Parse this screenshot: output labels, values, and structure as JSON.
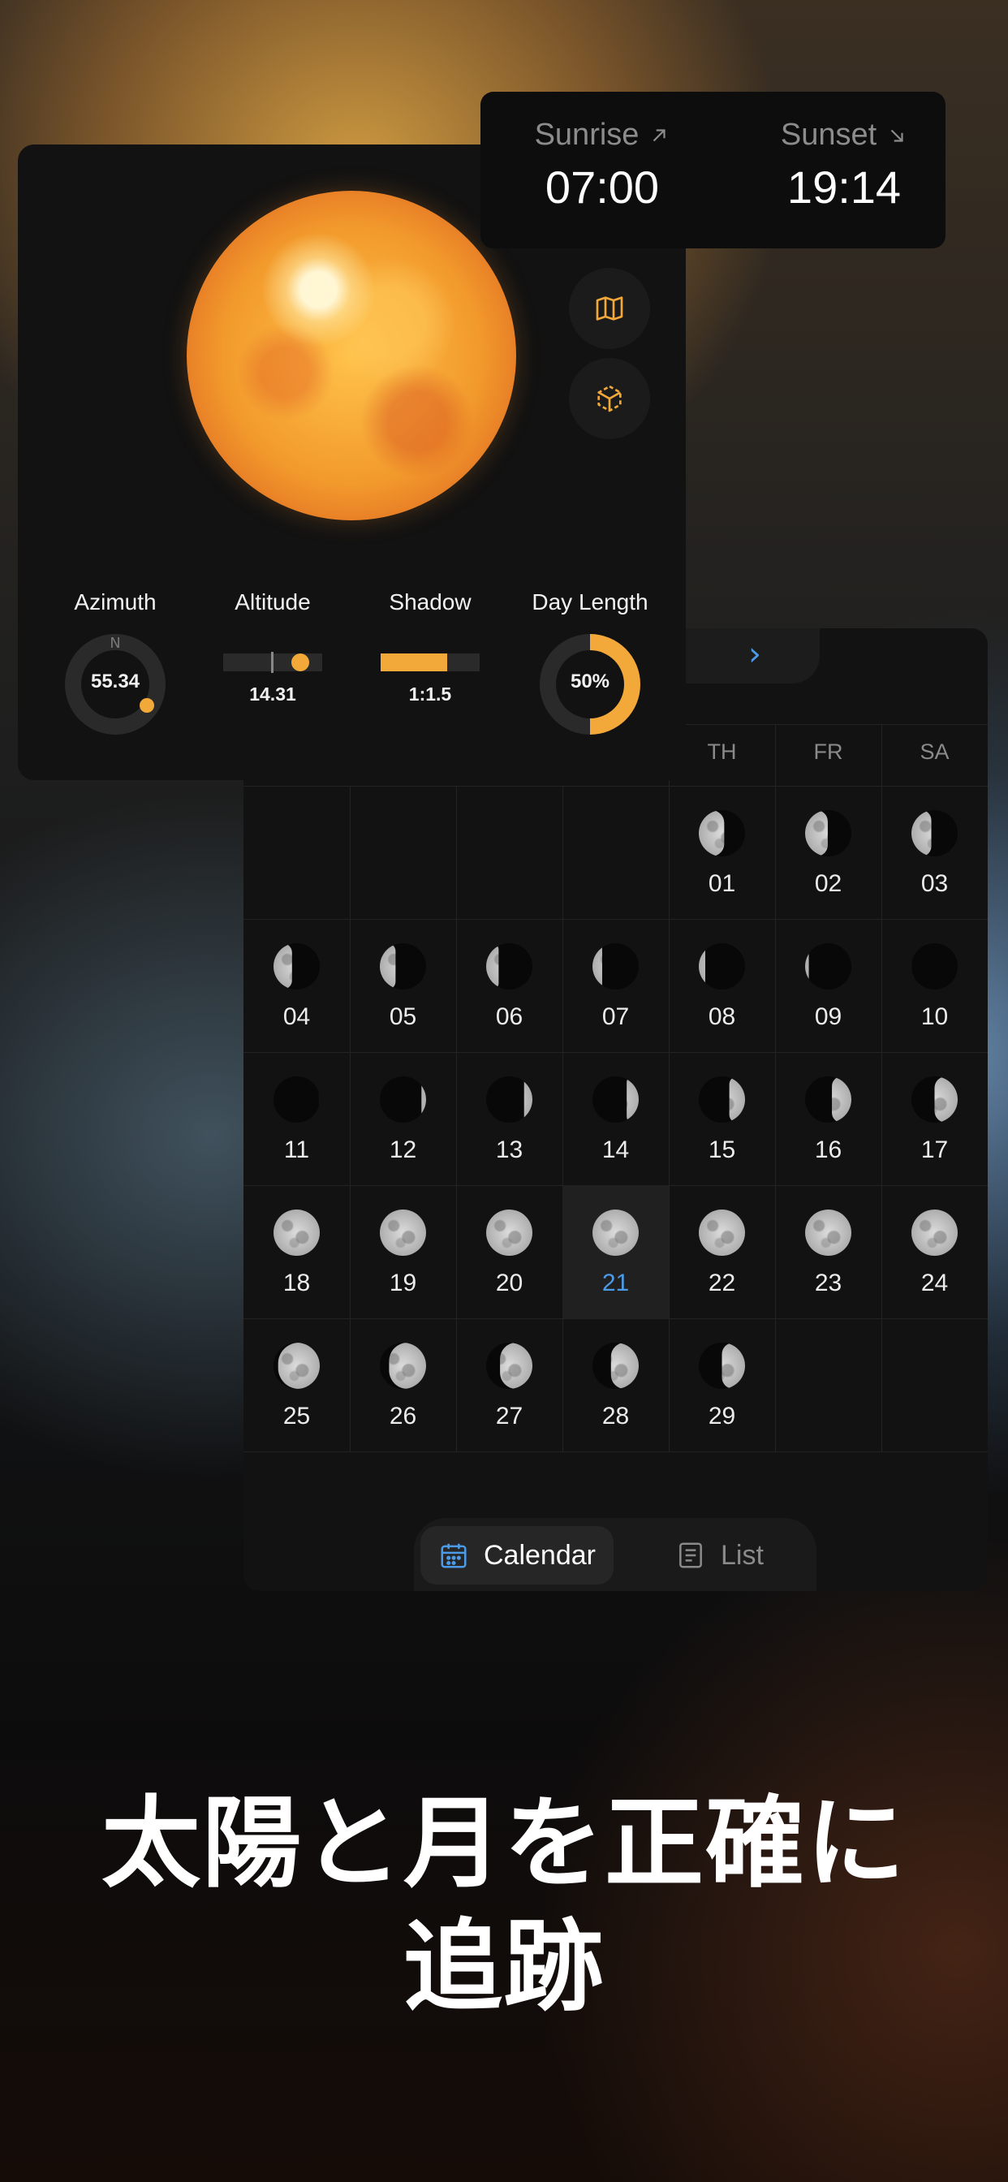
{
  "sunrise_card": {
    "sunrise_label": "Sunrise",
    "sunrise_time": "07:00",
    "sunset_label": "Sunset",
    "sunset_time": "19:14"
  },
  "sun_panel": {
    "icons": [
      "map-icon",
      "cube-icon"
    ],
    "metrics": {
      "azimuth_label": "Azimuth",
      "azimuth_compass": "N",
      "azimuth_value": "55.34",
      "altitude_label": "Altitude",
      "altitude_value": "14.31",
      "shadow_label": "Shadow",
      "shadow_value": "1:1.5",
      "day_length_label": "Day Length",
      "day_length_value": "50%",
      "day_length_fraction": 0.5
    },
    "accent_color": "#f3a83a"
  },
  "calendar": {
    "weekdays_visible": [
      "TH",
      "FR",
      "SA"
    ],
    "today": "21",
    "today_color": "#4c9be8",
    "days": [
      "01",
      "02",
      "03",
      "04",
      "05",
      "06",
      "07",
      "08",
      "09",
      "10",
      "11",
      "12",
      "13",
      "14",
      "15",
      "16",
      "17",
      "18",
      "19",
      "20",
      "21",
      "22",
      "23",
      "24",
      "25",
      "26",
      "27",
      "28",
      "29"
    ],
    "tabs": {
      "calendar_label": "Calendar",
      "list_label": "List"
    }
  },
  "headline": {
    "line1": "太陽と月を正確に",
    "line2": "追跡"
  }
}
